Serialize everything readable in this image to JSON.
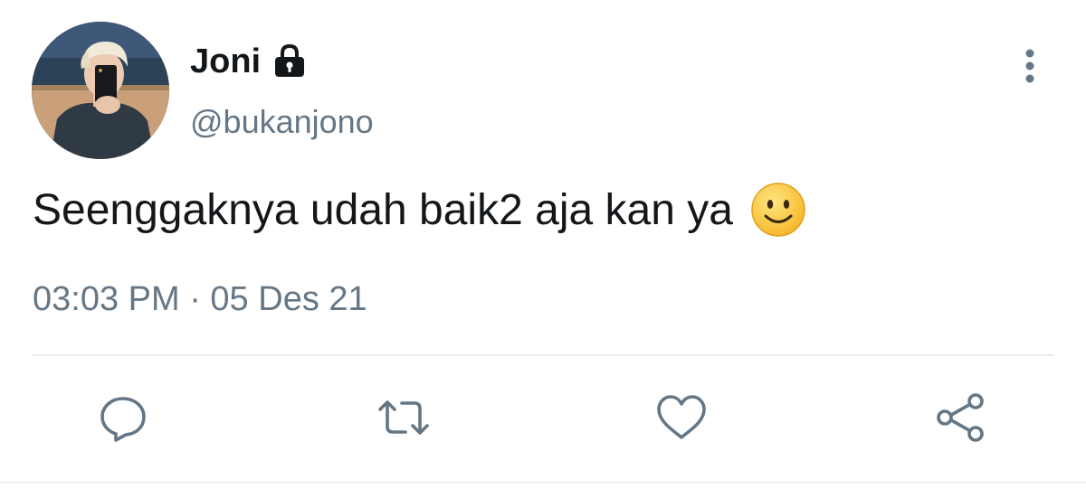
{
  "tweet": {
    "display_name": "Joni",
    "handle": "@bukanjono",
    "text": "Seenggaknya udah baik2 aja kan ya",
    "emoji": "slightly-smiling-face",
    "timestamp": "03:03 PM · 05 Des 21",
    "protected": true
  },
  "icons": {
    "lock": "lock-icon",
    "more": "more-vertical-icon",
    "reply": "reply-icon",
    "retweet": "retweet-icon",
    "like": "heart-icon",
    "share": "share-icon"
  },
  "colors": {
    "text_primary": "#14171a",
    "text_secondary": "#657786",
    "icon_gray": "#657786",
    "divider": "#e6ecf0",
    "emoji_yellow": "#ffd24a"
  }
}
